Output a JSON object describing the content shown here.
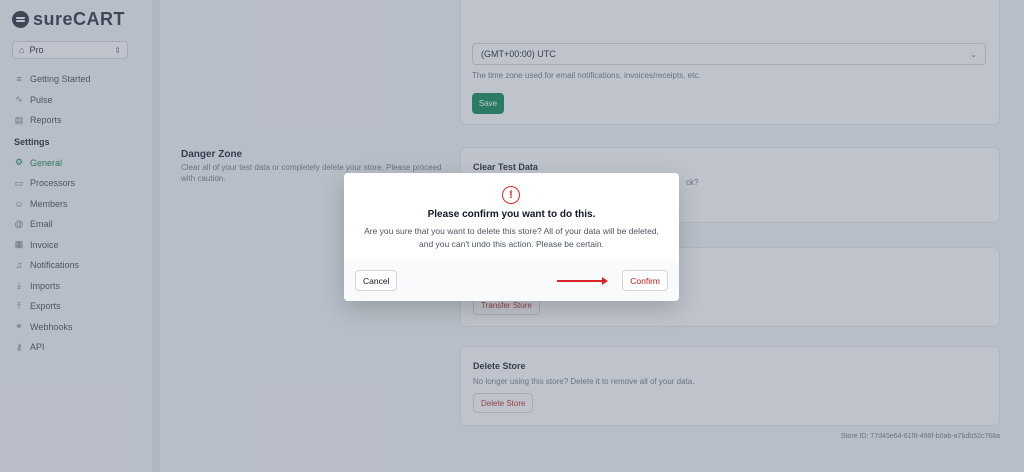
{
  "brand": {
    "name_bold": "sure",
    "name_rest": "CART"
  },
  "plan": {
    "label": "Pro"
  },
  "nav": {
    "top_items": [
      {
        "label": "Getting Started",
        "icon": "list-icon"
      },
      {
        "label": "Pulse",
        "icon": "activity-icon"
      },
      {
        "label": "Reports",
        "icon": "file-icon"
      }
    ],
    "settings_heading": "Settings",
    "settings_items": [
      {
        "label": "General",
        "icon": "gear-icon",
        "active": true
      },
      {
        "label": "Processors",
        "icon": "credit-card-icon"
      },
      {
        "label": "Members",
        "icon": "users-icon"
      },
      {
        "label": "Email",
        "icon": "at-sign-icon"
      },
      {
        "label": "Invoice",
        "icon": "invoice-icon"
      },
      {
        "label": "Notifications",
        "icon": "bell-icon"
      },
      {
        "label": "Imports",
        "icon": "download-icon"
      },
      {
        "label": "Exports",
        "icon": "upload-icon"
      },
      {
        "label": "Webhooks",
        "icon": "webhook-icon"
      },
      {
        "label": "API",
        "icon": "key-icon"
      }
    ]
  },
  "timezone": {
    "value": "(GMT+00:00) UTC",
    "helper": "The time zone used for email notifications, invoices/receipts, etc.",
    "save_label": "Save"
  },
  "danger_zone": {
    "title": "Danger Zone",
    "description": "Clear all of your test data or completely delete your store. Please proceed with caution.",
    "clear_test_data": {
      "title": "Clear Test Data",
      "description_tail": "ck?"
    },
    "transfer": {
      "button": "Transfer Store"
    },
    "delete_store": {
      "title": "Delete Store",
      "description": "No longer using this store? Delete it to remove all of your data.",
      "button": "Delete Store"
    }
  },
  "store_id": "Store ID: 77d45e64-61f8-498f-b0ab-a7bdb52c768a",
  "modal": {
    "icon": "!",
    "title": "Please confirm you want to do this.",
    "body": "Are you sure that you want to delete this store? All of your data will be deleted, and you can't undo this action. Please be certain.",
    "cancel_label": "Cancel",
    "confirm_label": "Confirm"
  },
  "colors": {
    "brand_green": "#01824c",
    "danger_red": "#dc2626",
    "overlay": "rgba(102,114,133,0.42)"
  }
}
